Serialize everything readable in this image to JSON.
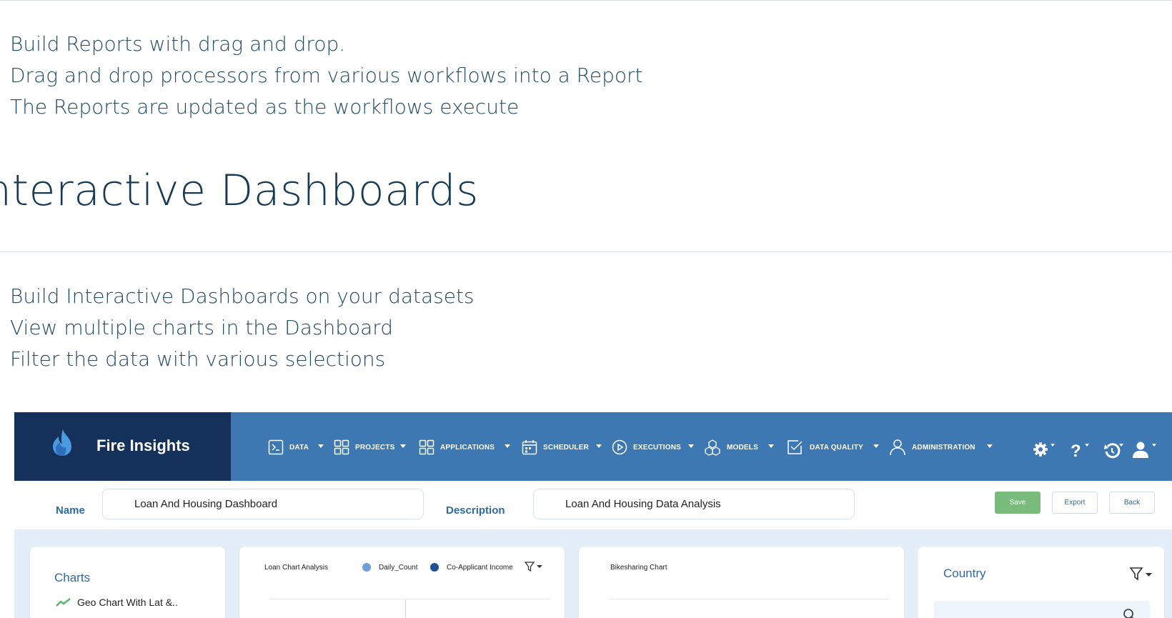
{
  "bullets_top": [
    "Build Reports with drag and drop.",
    "Drag and drop processors from various workflows into a Report",
    "The Reports are updated as the workflows execute"
  ],
  "section_title": "nteractive Dashboards",
  "bullets_bottom": [
    "Build Interactive Dashboards on your datasets",
    "View multiple charts in the Dashboard",
    "Filter the data with various selections"
  ],
  "app": {
    "brand": "Fire Insights",
    "nav": [
      {
        "label": "DATA",
        "icon": "terminal-icon"
      },
      {
        "label": "PROJECTS",
        "icon": "grid-icon"
      },
      {
        "label": "APPLICATIONS",
        "icon": "grid-icon"
      },
      {
        "label": "SCHEDULER",
        "icon": "calendar-icon"
      },
      {
        "label": "EXECUTIONS",
        "icon": "play-circle-icon"
      },
      {
        "label": "MODELS",
        "icon": "cubes-icon"
      },
      {
        "label": "DATA QUALITY",
        "icon": "checkbox-icon"
      },
      {
        "label": "ADMINISTRATION",
        "icon": "user-icon"
      }
    ],
    "form": {
      "name_label": "Name",
      "name_value": "Loan And Housing Dashboard",
      "description_label": "Description",
      "description_value": "Loan And Housing Data Analysis",
      "save": "Save",
      "export": "Export",
      "back": "Back"
    },
    "cards": {
      "charts_title": "Charts",
      "charts_item": "Geo Chart With Lat &..",
      "loan_title": "Loan Chart Analysis",
      "legend_1": "Daily_Count",
      "legend_2": "Co-Applicant Income",
      "bike_title": "Bikesharing Chart",
      "country_title": "Country"
    },
    "colors": {
      "nav_bg": "#3e78b3",
      "brand_bg": "#14315c",
      "save_green": "#78bb7b",
      "legend_1": "#6f9fd8",
      "legend_2": "#1f4f93"
    }
  }
}
